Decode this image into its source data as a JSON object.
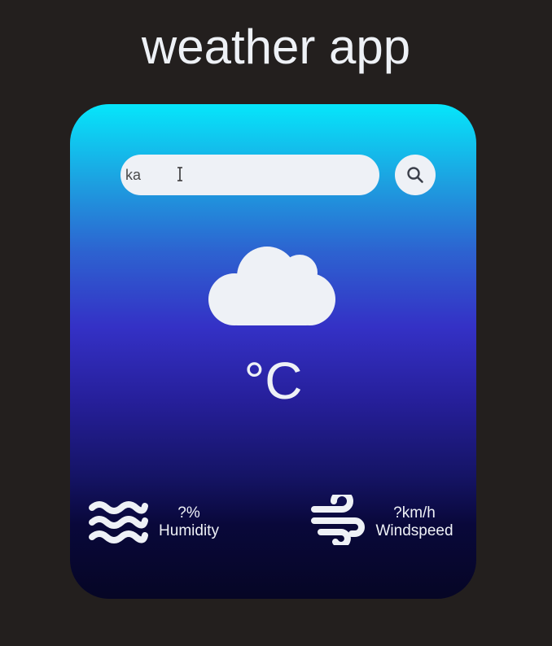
{
  "header": {
    "title": "weather app"
  },
  "search": {
    "value": "ka",
    "placeholder": ""
  },
  "icons": {
    "search": "search-icon",
    "weather": "cloud-icon",
    "humidity": "waves-icon",
    "wind": "wind-icon"
  },
  "weather": {
    "temperature": "°C",
    "humidity_value": "?%",
    "humidity_label": "Humidity",
    "wind_value": "?km/h",
    "wind_label": "Windspeed"
  },
  "colors": {
    "background": "#231f1e",
    "card_top": "#06e6fb",
    "card_middle": "#3431c6",
    "card_bottom": "#060625",
    "text_light": "#eef1f6"
  }
}
